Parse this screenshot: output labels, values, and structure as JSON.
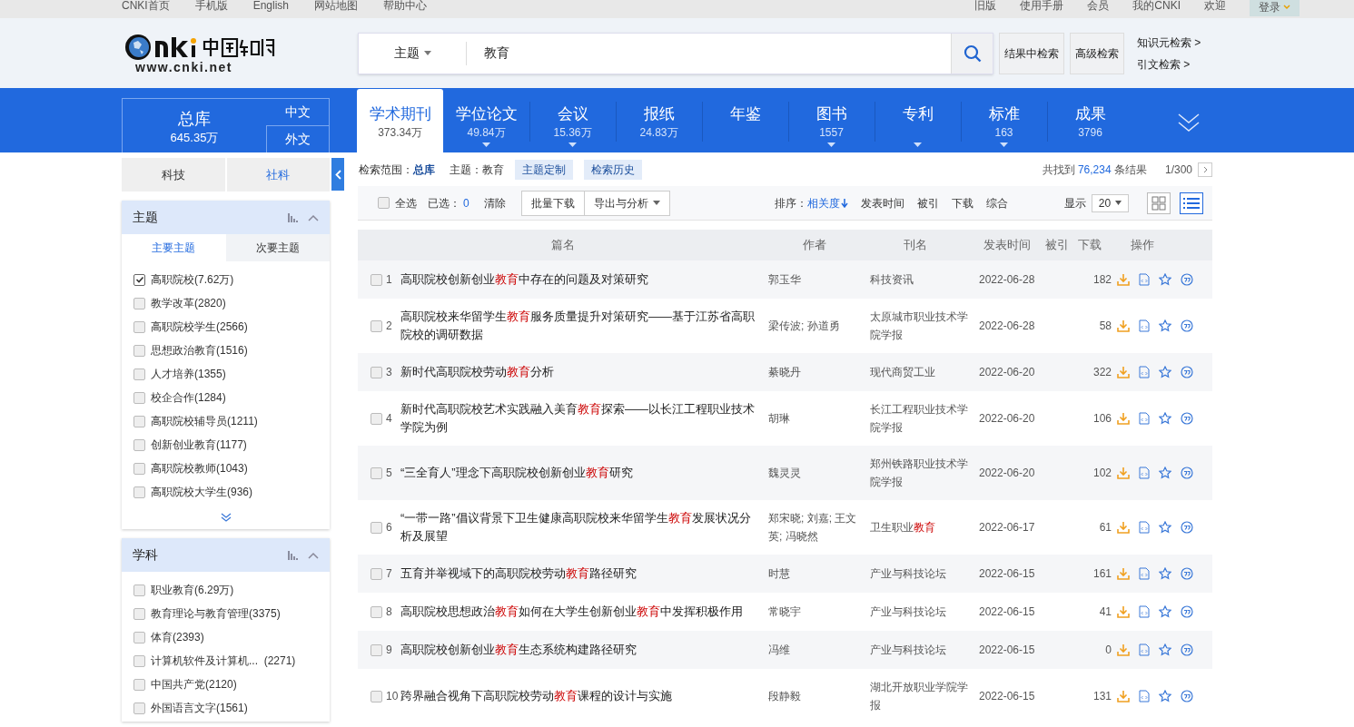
{
  "top_links": [
    "CNKI首页",
    "手机版",
    "English",
    "网站地图",
    "帮助中心"
  ],
  "top_right_links": [
    "旧版",
    "使用手册",
    "会员",
    "我的CNKI",
    "欢迎"
  ],
  "login_button": "登录",
  "logo": {
    "url": "www.cnki.net"
  },
  "search": {
    "field_type": "主题",
    "value": "教育",
    "buttons": [
      "结果中检索",
      "高级检索"
    ],
    "side_links": [
      "知识元检索 >",
      "引文检索 >"
    ]
  },
  "database": {
    "title": "总库",
    "count": "645.35万",
    "languages": [
      "中文",
      "外文"
    ]
  },
  "tabs": [
    {
      "label": "学术期刊",
      "count": "373.34万",
      "selected": true,
      "has_menu": false
    },
    {
      "label": "学位论文",
      "count": "49.84万",
      "selected": false,
      "has_menu": true
    },
    {
      "label": "会议",
      "count": "15.36万",
      "selected": false,
      "has_menu": true
    },
    {
      "label": "报纸",
      "count": "24.83万",
      "selected": false,
      "has_menu": false
    },
    {
      "label": "年鉴",
      "selected": false,
      "has_menu": false
    },
    {
      "label": "图书",
      "count": "1557",
      "selected": false,
      "has_menu": true
    },
    {
      "label": "专利",
      "selected": false,
      "has_menu": true
    },
    {
      "label": "标准",
      "count": "163",
      "selected": false,
      "has_menu": true
    },
    {
      "label": "成果",
      "count": "3796",
      "selected": false,
      "has_menu": false
    }
  ],
  "sidebar": {
    "categories": [
      {
        "label": "科技",
        "selected": false
      },
      {
        "label": "社科",
        "selected": false
      }
    ],
    "panels": [
      {
        "title": "主题",
        "subtabs": [
          {
            "label": "主要主题",
            "selected": true
          },
          {
            "label": "次要主题",
            "selected": false
          }
        ],
        "items": [
          {
            "label": "高职院校(7.62万)",
            "checked": true
          },
          {
            "label": "教学改革(2820)",
            "checked": false
          },
          {
            "label": "高职院校学生(2566)",
            "checked": false
          },
          {
            "label": "思想政治教育(1516)",
            "checked": false
          },
          {
            "label": "人才培养(1355)",
            "checked": false
          },
          {
            "label": "校企合作(1284)",
            "checked": false
          },
          {
            "label": "高职院校辅导员(1211)",
            "checked": false
          },
          {
            "label": "创新创业教育(1177)",
            "checked": false
          },
          {
            "label": "高职院校教师(1043)",
            "checked": false
          },
          {
            "label": "高职院校大学生(936)",
            "checked": false
          }
        ],
        "more": true
      },
      {
        "title": "学科",
        "items": [
          {
            "label": "职业教育(6.29万)",
            "checked": false
          },
          {
            "label": "教育理论与教育管理(3375)",
            "checked": false
          },
          {
            "label": "体育(2393)",
            "checked": false
          },
          {
            "label": "计算机软件及计算机...  (2271)",
            "checked": false
          },
          {
            "label": "中国共产党(2120)",
            "checked": false
          },
          {
            "label": "外国语言文字(1561)",
            "checked": false
          }
        ],
        "more": false
      }
    ]
  },
  "scope": {
    "label": "检索范围：",
    "value": "总库",
    "topic": "主题：教育",
    "buttons": [
      "主题定制",
      "检索历史"
    ],
    "found_prefix": "共找到",
    "found_count": "76,234",
    "found_suffix": "条结果",
    "page": "1/300"
  },
  "toolbar": {
    "select_all": "全选",
    "selected_label": "已选：",
    "selected_count": "0",
    "clear": "清除",
    "buttons": [
      "批量下载",
      "导出与分析"
    ],
    "sort_label": "排序：",
    "sorts": [
      {
        "label": "相关度",
        "selected": true
      },
      {
        "label": "发表时间",
        "selected": false
      },
      {
        "label": "被引",
        "selected": false
      },
      {
        "label": "下载",
        "selected": false
      },
      {
        "label": "综合",
        "selected": false
      }
    ],
    "show_label": "显示",
    "page_size": "20",
    "select_all_checked": false,
    "views": [
      {
        "kind": "grid",
        "selected": false
      },
      {
        "kind": "list",
        "selected": true
      }
    ]
  },
  "table": {
    "columns": [
      "篇名",
      "作者",
      "刊名",
      "发表时间",
      "被引",
      "下载",
      "操作"
    ],
    "rows": [
      {
        "no": "1",
        "title": "高职院校创新创业**教育**中存在的问题及对策研究",
        "authors": "郭玉华",
        "journal": "科技资讯",
        "date": "2022-06-28",
        "downloads": "182",
        "checked": false
      },
      {
        "no": "2",
        "title": "高职院校来华留学生**教育**服务质量提升对策研究——基于江苏省高职院校的调研数据",
        "authors": "梁传波; 孙道勇",
        "journal": "太原城市职业技术学院学报",
        "date": "2022-06-28",
        "downloads": "58",
        "checked": false
      },
      {
        "no": "3",
        "title": "新时代高职院校劳动**教育**分析",
        "authors": "綦晓丹",
        "journal": "现代商贸工业",
        "date": "2022-06-20",
        "downloads": "322",
        "checked": false
      },
      {
        "no": "4",
        "title": "新时代高职院校艺术实践融入美育**教育**探索——以长江工程职业技术学院为例",
        "authors": "胡琳",
        "journal": "长江工程职业技术学院学报",
        "date": "2022-06-20",
        "downloads": "106",
        "checked": false
      },
      {
        "no": "5",
        "title": "“三全育人”理念下高职院校创新创业**教育**研究",
        "authors": "魏灵灵",
        "journal": "郑州铁路职业技术学院学报",
        "date": "2022-06-20",
        "downloads": "102",
        "checked": false
      },
      {
        "no": "6",
        "title": "“一带一路”倡议背景下卫生健康高职院校来华留学生**教育**发展状况分析及展望",
        "authors": "郑宋晓; 刘嘉; 王文英; 冯晓然",
        "journal": "卫生职业**教育**",
        "date": "2022-06-17",
        "downloads": "61",
        "checked": false
      },
      {
        "no": "7",
        "title": "五育并举视域下的高职院校劳动**教育**路径研究",
        "authors": "时慧",
        "journal": "产业与科技论坛",
        "date": "2022-06-15",
        "downloads": "161",
        "checked": false
      },
      {
        "no": "8",
        "title": "高职院校思想政治**教育**如何在大学生创新创业**教育**中发挥积极作用",
        "authors": "常晓宇",
        "journal": "产业与科技论坛",
        "date": "2022-06-15",
        "downloads": "41",
        "checked": false
      },
      {
        "no": "9",
        "title": "高职院校创新创业**教育**生态系统构建路径研究",
        "authors": "冯维",
        "journal": "产业与科技论坛",
        "date": "2022-06-15",
        "downloads": "0",
        "checked": false
      },
      {
        "no": "10",
        "title": "跨界融合视角下高职院校劳动**教育**课程的设计与实施",
        "authors": "段静毅",
        "journal": "湖北开放职业学院学报",
        "date": "2022-06-15",
        "downloads": "131",
        "checked": false
      }
    ]
  }
}
